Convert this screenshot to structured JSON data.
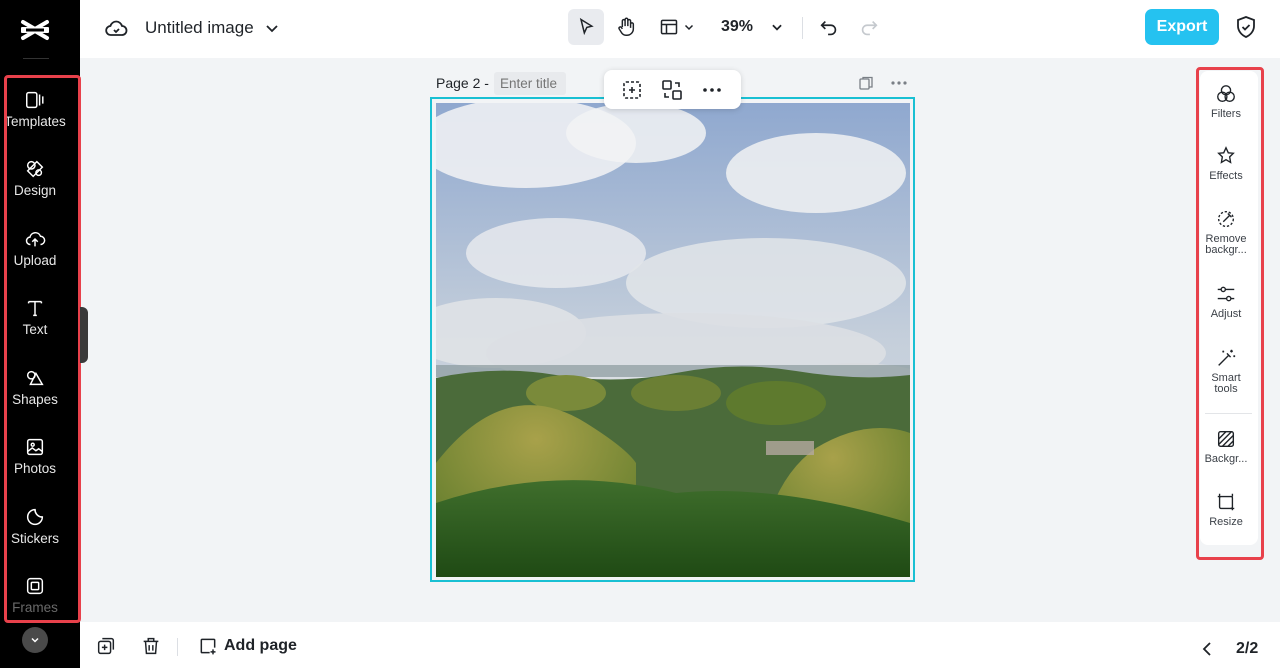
{
  "app": {
    "document_title": "Untitled image"
  },
  "sidebar": {
    "items": [
      {
        "key": "templates",
        "label": "Templates"
      },
      {
        "key": "design",
        "label": "Design"
      },
      {
        "key": "upload",
        "label": "Upload"
      },
      {
        "key": "text",
        "label": "Text"
      },
      {
        "key": "shapes",
        "label": "Shapes"
      },
      {
        "key": "photos",
        "label": "Photos"
      },
      {
        "key": "stickers",
        "label": "Stickers"
      },
      {
        "key": "frames",
        "label": "Frames"
      }
    ]
  },
  "topbar": {
    "zoom": "39%",
    "export_label": "Export"
  },
  "canvas": {
    "page_label": "Page 2 -",
    "title_placeholder": "Enter title"
  },
  "right_panel": {
    "items": [
      {
        "key": "filters",
        "label": "Filters"
      },
      {
        "key": "effects",
        "label": "Effects"
      },
      {
        "key": "remove-background",
        "label": "Remove backgr..."
      },
      {
        "key": "adjust",
        "label": "Adjust"
      },
      {
        "key": "smart-tools",
        "label": "Smart tools"
      },
      {
        "key": "background",
        "label": "Backgr..."
      },
      {
        "key": "resize",
        "label": "Resize"
      }
    ]
  },
  "bottombar": {
    "add_page_label": "Add page",
    "page_count": "2/2"
  },
  "colors": {
    "accent": "#25c2f0",
    "selection": "#19c0d3",
    "highlight_outline": "#e8414b",
    "sidebar_bg": "#000000"
  }
}
